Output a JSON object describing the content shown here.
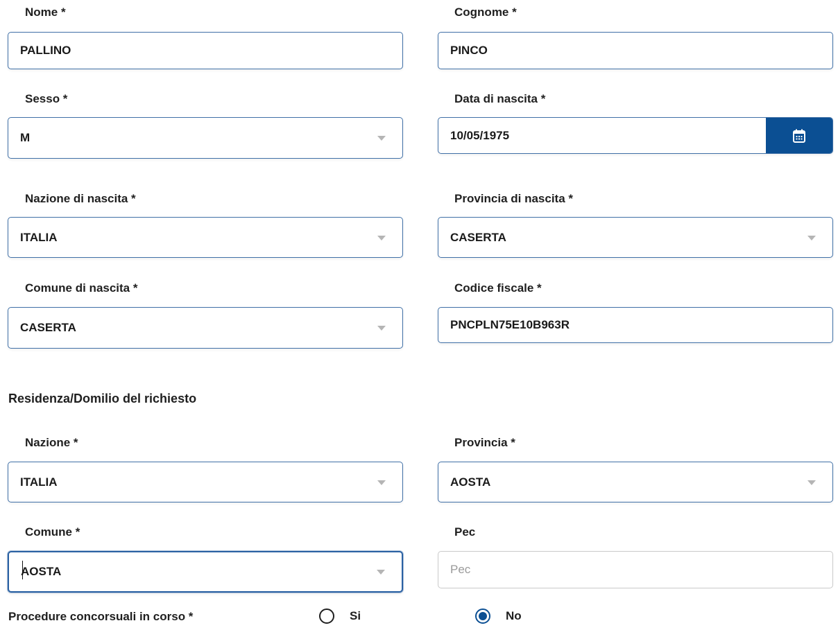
{
  "personal": {
    "nome": {
      "label": "Nome *",
      "value": "PALLINO"
    },
    "cognome": {
      "label": "Cognome *",
      "value": "PINCO"
    },
    "sesso": {
      "label": "Sesso *",
      "value": "M"
    },
    "data_nascita": {
      "label": "Data di nascita *",
      "value": "10/05/1975",
      "button_icon": "calendar-icon"
    },
    "nazione_nascita": {
      "label": "Nazione di nascita *",
      "value": "ITALIA"
    },
    "provincia_nascita": {
      "label": "Provincia di nascita *",
      "value": "CASERTA"
    },
    "comune_nascita": {
      "label": "Comune di nascita *",
      "value": "CASERTA"
    },
    "codice_fiscale": {
      "label": "Codice fiscale *",
      "value": "PNCPLN75E10B963R"
    }
  },
  "residenza": {
    "title": "Residenza/Domilio del richiesto",
    "nazione": {
      "label": "Nazione *",
      "value": "ITALIA"
    },
    "provincia": {
      "label": "Provincia *",
      "value": "AOSTA"
    },
    "comune": {
      "label": "Comune *",
      "value": "AOSTA"
    },
    "pec": {
      "label": "Pec",
      "value": "",
      "placeholder": "Pec"
    }
  },
  "procedure": {
    "label": "Procedure concorsuali in corso *",
    "options": [
      {
        "label": "Si",
        "selected": false
      },
      {
        "label": "No",
        "selected": true
      }
    ]
  },
  "colors": {
    "accent": "#0b4f93",
    "field_border": "#3f6fa6",
    "caret": "#b5b5b5"
  }
}
